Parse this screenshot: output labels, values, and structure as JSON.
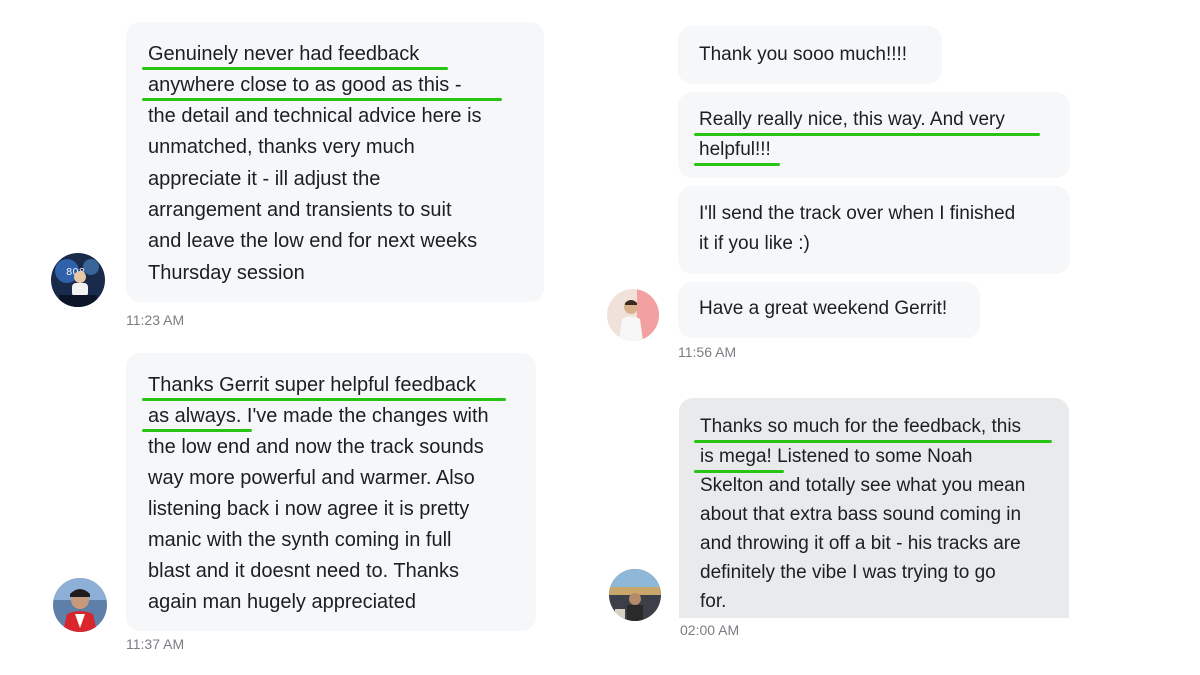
{
  "left_thread": {
    "message_1": {
      "lines": [
        "Genuinely never had feedback",
        "anywhere close to as good as this -",
        "the detail and technical advice here is",
        "unmatched, thanks very much",
        "appreciate it - ill adjust the",
        "arrangement and transients to suit",
        "and leave the low end for next weeks",
        "Thursday session"
      ],
      "time": "11:23 AM",
      "avatar_label": "808"
    },
    "message_2": {
      "lines": [
        "Thanks Gerrit super helpful feedback",
        "as always. I've made the changes with",
        "the low end and now the track sounds",
        "way more powerful and warmer. Also",
        "listening back i now agree it is pretty",
        "manic with the synth coming in full",
        "blast and it doesnt need to. Thanks",
        "again man hugely appreciated"
      ],
      "time": "11:37 AM"
    }
  },
  "right_thread": {
    "group_1": {
      "bubbles": [
        [
          "Thank you sooo much!!!!"
        ],
        [
          "Really really nice, this way. And very",
          "helpful!!!"
        ],
        [
          "I'll send the track over when I finished",
          "it if you like :)"
        ],
        [
          "Have a great weekend Gerrit!"
        ]
      ],
      "time": "11:56 AM"
    },
    "message_3": {
      "lines": [
        "Thanks so much for the feedback, this",
        "is mega! Listened to some Noah",
        "Skelton and totally see what you mean",
        "about that extra bass sound coming in",
        "and throwing it off a bit - his tracks are",
        "definitely the vibe I was trying to go",
        "for."
      ],
      "time": "02:00 AM"
    }
  },
  "colors": {
    "highlight_underline": "#27c416",
    "bubble": "#f6f7f9",
    "bubble_dark": "#e9eaec",
    "timestamp": "#7a7d83"
  }
}
